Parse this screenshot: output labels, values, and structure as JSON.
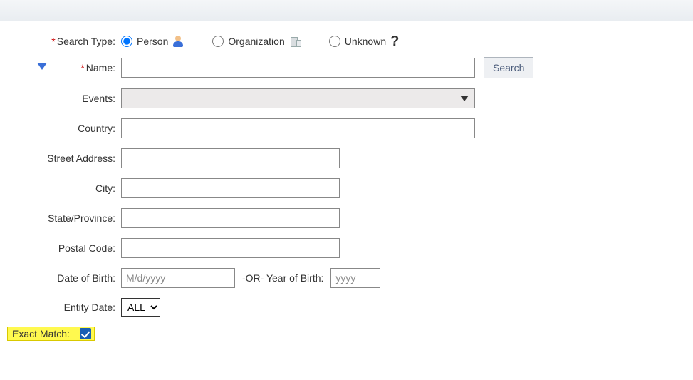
{
  "labels": {
    "search_type": "Search Type:",
    "name": "Name:",
    "events": "Events:",
    "country": "Country:",
    "street": "Street Address:",
    "city": "City:",
    "state": "State/Province:",
    "postal": "Postal Code:",
    "dob": "Date of Birth:",
    "or_yob": "-OR- Year of Birth:",
    "entity_date": "Entity Date:",
    "exact_match": "Exact Match:"
  },
  "search_type_options": {
    "person": "Person",
    "organization": "Organization",
    "unknown": "Unknown"
  },
  "placeholders": {
    "dob": "M/d/yyyy",
    "yob": "yyyy"
  },
  "entity_date_selected": "ALL",
  "search_button": "Search",
  "exact_match_checked": true
}
